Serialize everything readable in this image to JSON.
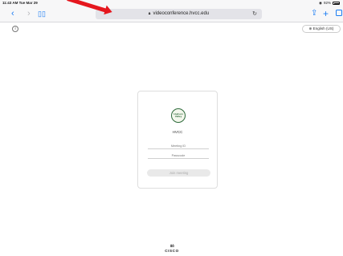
{
  "status_bar": {
    "time": "11:43 AM  Tue Mar 29",
    "battery": "92%"
  },
  "toolbar": {
    "url": "videoconference.hvcc.edu",
    "icons": {
      "back": "chevron-left-icon",
      "forward": "chevron-right-icon",
      "bookmarks": "book-icon",
      "lock": "lock-icon",
      "reload": "reload-icon",
      "share": "share-icon",
      "new_tab": "plus-icon",
      "tabs": "tabs-icon"
    }
  },
  "page": {
    "language_label": "English (US)",
    "org_name": "HVCC",
    "meeting_id_placeholder": "Meeting ID",
    "passcode_placeholder": "Passcode",
    "join_label": "Join meeting",
    "footer_brand": "CISCO"
  },
  "colors": {
    "accent": "#1a7cf3",
    "annotation_arrow": "#e5171e",
    "logo_green": "#2d6a3a"
  }
}
